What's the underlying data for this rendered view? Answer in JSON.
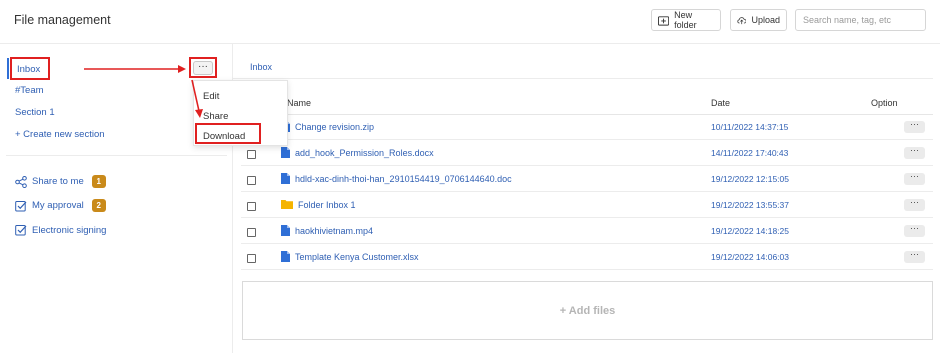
{
  "header": {
    "title": "File management",
    "new_folder_label": "New folder",
    "upload_label": "Upload",
    "search_placeholder": "Search name, tag, etc"
  },
  "sidebar": {
    "sections": [
      {
        "label": "Inbox"
      },
      {
        "label": "#Team"
      },
      {
        "label": "Section 1"
      }
    ],
    "create_label": "+ Create new section",
    "links": [
      {
        "label": "Share to me",
        "badge": "1",
        "icon": "share-icon"
      },
      {
        "label": "My approval",
        "badge": "2",
        "icon": "checkbox-icon"
      },
      {
        "label": "Electronic signing",
        "icon": "checkbox-icon"
      }
    ],
    "badge_color": "#c98a1a"
  },
  "section_menu": {
    "trigger": "···",
    "items": [
      {
        "label": "Edit"
      },
      {
        "label": "Share"
      },
      {
        "label": "Download"
      }
    ]
  },
  "main": {
    "breadcrumb": "Inbox",
    "columns": {
      "name": "Name",
      "date": "Date",
      "option": "Option"
    },
    "rows": [
      {
        "name": "Change revision.zip",
        "date": "10/11/2022 14:37:15",
        "type": "file"
      },
      {
        "name": "add_hook_Permission_Roles.docx",
        "date": "14/11/2022 17:40:43",
        "type": "file"
      },
      {
        "name": "hdld-xac-dinh-thoi-han_2910154419_0706144640.doc",
        "date": "19/12/2022 12:15:05",
        "type": "file"
      },
      {
        "name": "Folder Inbox 1",
        "date": "19/12/2022 13:55:37",
        "type": "folder"
      },
      {
        "name": "haokhivietnam.mp4",
        "date": "19/12/2022 14:18:25",
        "type": "file"
      },
      {
        "name": "Template Kenya Customer.xlsx",
        "date": "19/12/2022 14:06:03",
        "type": "file"
      }
    ],
    "row_option": "···",
    "add_files_label": "+ Add files"
  },
  "colors": {
    "link": "#2f5fb3",
    "accent": "#2f6fd6",
    "folder": "#f5b400",
    "annotation": "#e02020"
  }
}
